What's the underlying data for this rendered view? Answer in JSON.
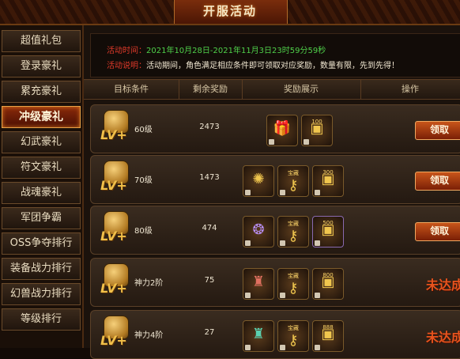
{
  "header": {
    "title": "开服活动"
  },
  "sidebar": {
    "items": [
      {
        "label": "超值礼包"
      },
      {
        "label": "登录豪礼"
      },
      {
        "label": "累充豪礼"
      },
      {
        "label": "冲级豪礼",
        "active": true
      },
      {
        "label": "幻武豪礼"
      },
      {
        "label": "符文豪礼"
      },
      {
        "label": "战魂豪礼"
      },
      {
        "label": "军团争霸"
      },
      {
        "label": "OSS争夺排行"
      },
      {
        "label": "装备战力排行"
      },
      {
        "label": "幻兽战力排行"
      },
      {
        "label": "等级排行"
      }
    ]
  },
  "info": {
    "time_label": "活动时间：",
    "time_value": "2021年10月28日-2021年11月3日23时59分59秒",
    "desc_label": "活动说明：",
    "desc_value": "活动期间，角色满足相应条件即可领取对应奖励，数量有限，先到先得！"
  },
  "table": {
    "headers": [
      "目标条件",
      "剩余奖励",
      "奖励展示",
      "操作"
    ],
    "rows": [
      {
        "target": "60级",
        "remaining": "2473",
        "rewards": [
          {
            "icon": "gift-box-icon"
          },
          {
            "icon": "gold-card-icon",
            "caption": "100"
          }
        ],
        "action": "领取"
      },
      {
        "target": "70级",
        "remaining": "1473",
        "rewards": [
          {
            "icon": "pet-egg-icon"
          },
          {
            "icon": "gold-key-icon",
            "caption": "宝藏"
          },
          {
            "icon": "gold-card-icon",
            "caption": "300"
          }
        ],
        "action": "领取"
      },
      {
        "target": "80级",
        "remaining": "474",
        "rewards": [
          {
            "icon": "emblem-icon"
          },
          {
            "icon": "gold-key-icon",
            "caption": "宝藏"
          },
          {
            "icon": "gold-card-icon",
            "caption": "500"
          }
        ],
        "action": "领取"
      },
      {
        "target": "神力2阶",
        "remaining": "75",
        "rewards": [
          {
            "icon": "armor-icon"
          },
          {
            "icon": "gold-key-icon",
            "caption": "宝藏"
          },
          {
            "icon": "gold-card-icon",
            "caption": "800"
          }
        ],
        "status": "未达成"
      },
      {
        "target": "神力4阶",
        "remaining": "27",
        "rewards": [
          {
            "icon": "armor-icon"
          },
          {
            "icon": "gold-key-icon",
            "caption": "宝藏"
          },
          {
            "icon": "gold-card-icon",
            "caption": "888"
          }
        ],
        "status": "未达成"
      }
    ]
  },
  "level_badge": "LV+",
  "colors": {
    "accent": "#e8541e",
    "highlight_green": "#4fd04a",
    "label_red": "#e03a2a"
  }
}
